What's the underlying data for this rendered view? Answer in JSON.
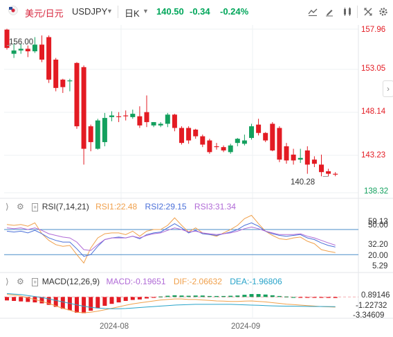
{
  "header": {
    "pair_name": "美元/日元",
    "symbol": "USDJPY",
    "timeframe": "日K",
    "price": "140.50",
    "change": "-0.34",
    "change_pct": "-0.24%"
  },
  "price_axis": [
    "157.96",
    "153.05",
    "148.14",
    "143.23",
    "138.32"
  ],
  "annotations": {
    "high": "156.00",
    "low": "140.28"
  },
  "rsi": {
    "title": "RSI(7,14,21)",
    "rsi1": "RSI1:22.48",
    "rsi2": "RSI2:29.15",
    "rsi3": "RSI3:31.34",
    "axis": [
      "59.13",
      "50.00",
      "32.20",
      "20.00",
      "5.29"
    ]
  },
  "macd": {
    "title": "MACD(12,26,9)",
    "macd": "MACD:-0.19651",
    "dif": "DIF:-2.06632",
    "dea": "DEA:-1.96806",
    "axis": [
      "0.89146",
      "-1.22732",
      "-3.34609"
    ]
  },
  "time_axis": [
    "2024-08",
    "2024-09"
  ],
  "colors": {
    "up": "#13a05e",
    "down": "#e31b23",
    "rsi1": "#f0a04b",
    "rsi2": "#4a6fd8",
    "rsi3": "#b06ad6",
    "dif": "#f0a04b",
    "dea": "#27a3c9",
    "grid": "#eef0f3",
    "accent_up": "#00a65a"
  },
  "chart_data": [
    {
      "type": "candlestick",
      "title": "",
      "x": [
        "2024-07-12",
        "2024-07-15",
        "2024-07-16",
        "2024-07-17",
        "2024-07-18",
        "2024-07-19",
        "2024-07-22",
        "2024-07-23",
        "2024-07-24",
        "2024-07-25",
        "2024-07-26",
        "2024-07-29",
        "2024-07-30",
        "2024-07-31",
        "2024-08-01",
        "2024-08-02",
        "2024-08-05",
        "2024-08-06",
        "2024-08-07",
        "2024-08-08",
        "2024-08-09",
        "2024-08-12",
        "2024-08-13",
        "2024-08-14",
        "2024-08-15",
        "2024-08-16",
        "2024-08-19",
        "2024-08-20",
        "2024-08-21",
        "2024-08-22",
        "2024-08-23",
        "2024-08-26",
        "2024-08-27",
        "2024-08-28",
        "2024-08-29",
        "2024-08-30",
        "2024-09-02",
        "2024-09-03",
        "2024-09-04",
        "2024-09-05",
        "2024-09-06",
        "2024-09-09",
        "2024-09-10",
        "2024-09-11",
        "2024-09-12",
        "2024-09-13",
        "2024-09-16",
        "2024-09-17"
      ],
      "open": [
        157.9,
        155.0,
        155.4,
        155.6,
        155.3,
        156.1,
        157.0,
        154.3,
        151.9,
        151.8,
        153.9,
        153.4,
        146.3,
        143.6,
        144.4,
        147.4,
        147.5,
        147.6,
        147.4,
        147.5,
        148.0,
        146.4,
        146.4,
        146.6,
        147.7,
        146.1,
        146.1,
        145.9,
        145.1,
        144.6,
        143.9,
        143.8,
        143.2,
        144.3,
        144.2,
        144.9,
        146.5,
        145.5,
        146.6,
        146.1,
        143.9,
        142.9,
        142.3,
        143.4,
        142.3,
        141.7,
        140.9,
        140.6
      ],
      "close": [
        155.7,
        155.4,
        155.6,
        155.3,
        156.1,
        154.3,
        151.9,
        150.9,
        151.0,
        151.8,
        146.3,
        143.6,
        144.4,
        147.0,
        147.3,
        147.6,
        147.4,
        147.5,
        147.8,
        146.4,
        146.8,
        146.8,
        146.6,
        147.7,
        146.1,
        144.3,
        144.6,
        145.1,
        144.1,
        143.2,
        143.8,
        143.4,
        144.0,
        144.8,
        144.6,
        146.3,
        145.5,
        144.6,
        143.4,
        142.3,
        142.2,
        142.2,
        142.5,
        141.7,
        141.8,
        140.8,
        140.6,
        140.5
      ],
      "high": [
        158.0,
        156.2,
        156.2,
        156.0,
        157.0,
        157.2,
        157.2,
        154.5,
        152.0,
        152.0,
        154.0,
        153.6,
        146.5,
        147.2,
        147.9,
        148.1,
        148.0,
        148.2,
        148.3,
        148.7,
        150.0,
        146.8,
        146.8,
        147.9,
        147.8,
        146.3,
        146.3,
        146.0,
        145.3,
        144.8,
        144.3,
        144.0,
        144.2,
        144.9,
        145.3,
        146.6,
        147.2,
        145.6,
        146.8,
        146.3,
        144.3,
        143.6,
        143.6,
        143.9,
        142.7,
        142.9,
        141.2,
        140.8
      ],
      "low": [
        155.5,
        154.5,
        155.0,
        154.6,
        155.1,
        154.0,
        151.5,
        150.5,
        150.3,
        150.5,
        146.0,
        141.7,
        143.3,
        143.5,
        143.9,
        146.9,
        146.8,
        147.0,
        147.2,
        146.1,
        146.2,
        146.2,
        146.2,
        146.2,
        145.7,
        144.1,
        144.2,
        144.8,
        143.8,
        143.0,
        143.5,
        143.2,
        143.0,
        143.9,
        144.0,
        144.7,
        145.2,
        144.4,
        143.3,
        142.0,
        141.8,
        141.7,
        141.9,
        140.6,
        141.4,
        140.3,
        140.3,
        140.3
      ]
    },
    {
      "type": "line",
      "title": "RSI(7,14,21)",
      "series": [
        {
          "name": "RSI1",
          "values": [
            56,
            55,
            56,
            54,
            58,
            45,
            37,
            32,
            30,
            31,
            20,
            10,
            28,
            40,
            45,
            46,
            46,
            44,
            48,
            42,
            48,
            50,
            50,
            55,
            64,
            55,
            47,
            52,
            46,
            44,
            42,
            46,
            50,
            55,
            63,
            67,
            57,
            48,
            43,
            39,
            38,
            40,
            41,
            36,
            33,
            26,
            24,
            22.48
          ]
        },
        {
          "name": "RSI2",
          "values": [
            48,
            47,
            48,
            46,
            49,
            45,
            40,
            37,
            35,
            35,
            27,
            18,
            20,
            30,
            38,
            40,
            41,
            40,
            42,
            39,
            44,
            46,
            47,
            52,
            57,
            52,
            46,
            49,
            45,
            44,
            43,
            45,
            47,
            50,
            55,
            58,
            54,
            48,
            45,
            43,
            42,
            43,
            44,
            40,
            38,
            34,
            31,
            29.15
          ]
        },
        {
          "name": "RSI3",
          "values": [
            52,
            51,
            52,
            50,
            52,
            49,
            45,
            43,
            41,
            40,
            35,
            26,
            25,
            32,
            38,
            40,
            40,
            40,
            42,
            40,
            43,
            45,
            46,
            49,
            52,
            50,
            47,
            48,
            46,
            45,
            44,
            45,
            46,
            48,
            51,
            53,
            51,
            48,
            46,
            44,
            44,
            44,
            45,
            42,
            40,
            37,
            34,
            31.34
          ]
        }
      ],
      "ylim": [
        5.29,
        59.13
      ],
      "reference_lines": [
        50,
        20
      ]
    },
    {
      "type": "bar",
      "title": "MACD(12,26,9)",
      "series": [
        {
          "name": "MACD",
          "values": [
            -0.7,
            -0.8,
            -0.9,
            -1.0,
            -1.1,
            -1.3,
            -1.6,
            -2.0,
            -2.4,
            -2.7,
            -3.2,
            -3.3,
            -2.8,
            -2.3,
            -1.8,
            -1.4,
            -1.1,
            -0.8,
            -0.6,
            -0.5,
            -0.3,
            -0.1,
            0.1,
            0.25,
            0.35,
            0.3,
            0.25,
            0.3,
            0.3,
            0.2,
            0.2,
            0.2,
            0.25,
            0.3,
            0.45,
            0.6,
            0.6,
            0.5,
            0.35,
            0.2,
            0.1,
            0.0,
            -0.05,
            -0.08,
            -0.1,
            -0.15,
            -0.18,
            -0.19651
          ]
        },
        {
          "name": "DIF",
          "values": [
            0.5,
            0.4,
            0.2,
            -0.2,
            -0.5,
            -0.9,
            -1.3,
            -1.8,
            -2.3,
            -2.7,
            -3.1,
            -3.2,
            -3.1,
            -2.9,
            -2.6,
            -2.3,
            -2.0,
            -1.7,
            -1.4,
            -1.2,
            -1.0,
            -0.8,
            -0.6,
            -0.5,
            -0.4,
            -0.4,
            -0.5,
            -0.5,
            -0.6,
            -0.7,
            -0.8,
            -0.85,
            -0.9,
            -0.9,
            -0.85,
            -0.8,
            -0.9,
            -1.0,
            -1.15,
            -1.3,
            -1.45,
            -1.55,
            -1.65,
            -1.75,
            -1.85,
            -1.95,
            -2.0,
            -2.06632
          ]
        },
        {
          "name": "DEA",
          "values": [
            0.7,
            0.6,
            0.5,
            0.3,
            0.1,
            -0.1,
            -0.4,
            -0.7,
            -1.0,
            -1.3,
            -1.6,
            -1.9,
            -2.1,
            -2.25,
            -2.35,
            -2.4,
            -2.4,
            -2.35,
            -2.25,
            -2.15,
            -2.05,
            -1.95,
            -1.85,
            -1.75,
            -1.65,
            -1.6,
            -1.55,
            -1.5,
            -1.5,
            -1.5,
            -1.5,
            -1.5,
            -1.5,
            -1.55,
            -1.6,
            -1.65,
            -1.7,
            -1.75,
            -1.8,
            -1.85,
            -1.87,
            -1.88,
            -1.9,
            -1.92,
            -1.93,
            -1.94,
            -1.95,
            -1.96806
          ]
        }
      ],
      "ylim": [
        -3.34609,
        0.89146
      ]
    }
  ]
}
